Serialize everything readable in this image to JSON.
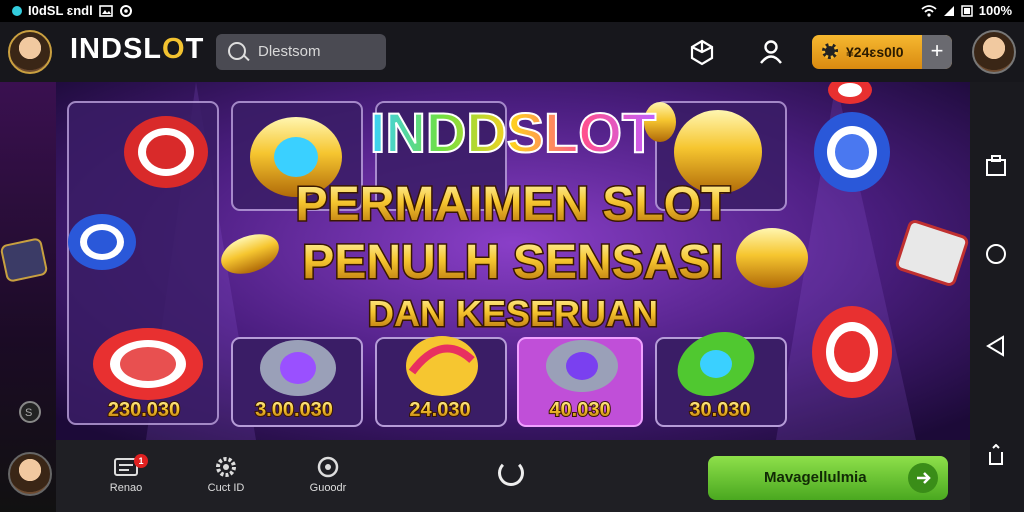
{
  "status_bar": {
    "left_text": "I0dSL ɛndl",
    "right_text": "100%"
  },
  "header": {
    "logo_text_a": "INDSL",
    "logo_text_b": "O",
    "logo_text_c": "T",
    "search_placeholder": "Dlestsom",
    "coins_value": "¥24ɛs0l0",
    "plus_label": "+"
  },
  "banner": {
    "brand": "INDDSLOT",
    "headline_1": "PERMAIMEN SLOT",
    "headline_2": "PENULH SENSASI",
    "headline_3": "DAN KESERUAN",
    "prizes": [
      "230.030",
      "3.00.030",
      "24.030",
      "40.030",
      "30.030"
    ]
  },
  "bottom_nav": {
    "item1": "Renao",
    "item1_badge": "1",
    "item2": "Cuct ID",
    "item3": "Guoodr",
    "cta_label": "Mavagellulmia"
  },
  "colors": {
    "accent_gold": "#f2c230",
    "cta_green": "#6cc832",
    "banner_purple": "#5a2a8a"
  }
}
